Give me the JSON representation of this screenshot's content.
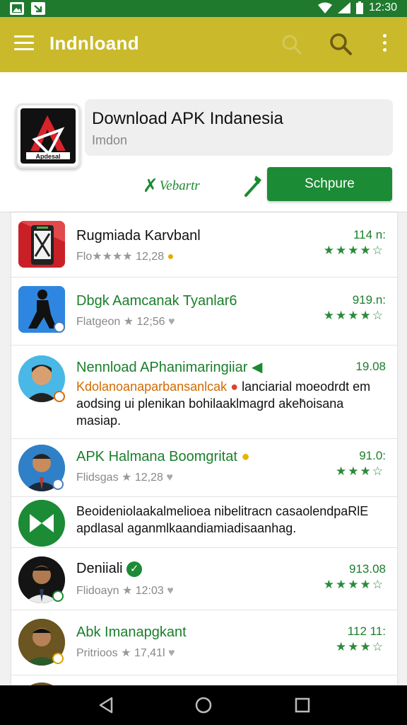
{
  "status_bar": {
    "time": "12:30"
  },
  "app_bar": {
    "title": "Indnloand"
  },
  "header": {
    "app_title": "Download APK Indanesia",
    "app_subtitle": "Imdon",
    "icon_text": "Apdesal",
    "secondary_action": "Vebartr",
    "primary_action": "Schpure",
    "colors": {
      "primary": "#1c8b35",
      "appbar": "#c9b92b",
      "status": "#1f7a2e"
    }
  },
  "list": {
    "items": [
      {
        "name": "Rugmiada Karvbanl",
        "meta": "Flo",
        "meta_stars": "★★★★",
        "time": "12,28",
        "size": "114 n:",
        "stars": "★★★★☆",
        "icon": "phone-app-icon"
      },
      {
        "name": "Dbgk Aamcanak Tyanlar6",
        "meta": "Flatgeon",
        "meta_stars": "★",
        "time": "12;56",
        "size": "919.n:",
        "stars": "★★★★☆",
        "icon": "person-silhouette-icon"
      },
      {
        "name": "Nennload APhanimaringiiar",
        "desc_orange": "Kdolanoanaparbansanlcak",
        "desc_rest": " lanciarial moeodrdt em aodsing ui plenikan bohilaaklmagrd akeh̄oisana masiap.",
        "size": "19.08",
        "icon": "avatar-icon"
      },
      {
        "name": "APK Halmana Boomgritat",
        "meta": "Flidsgas",
        "meta_stars": "★",
        "time": "12,28",
        "size": "91.0:",
        "stars": "★★★☆",
        "icon": "avatar-icon"
      },
      {
        "desc": "Beoideniolaakalmelioea nibelitracn casaolendpaRlE apdlasal aganmlkaandiamiadisaanhag.",
        "icon": "bowtie-logo-icon"
      },
      {
        "name": "Deniiali",
        "meta": "Flidoayn",
        "meta_stars": "★",
        "time": "12:03",
        "size": "913.08",
        "stars": "★★★★☆",
        "icon": "avatar-icon"
      },
      {
        "name": "Abk Imanapgkant",
        "meta": "Pritrioos",
        "meta_stars": "★",
        "time": "17,41l",
        "size": "112 11:",
        "stars": "★★★☆",
        "icon": "avatar-icon"
      }
    ]
  }
}
